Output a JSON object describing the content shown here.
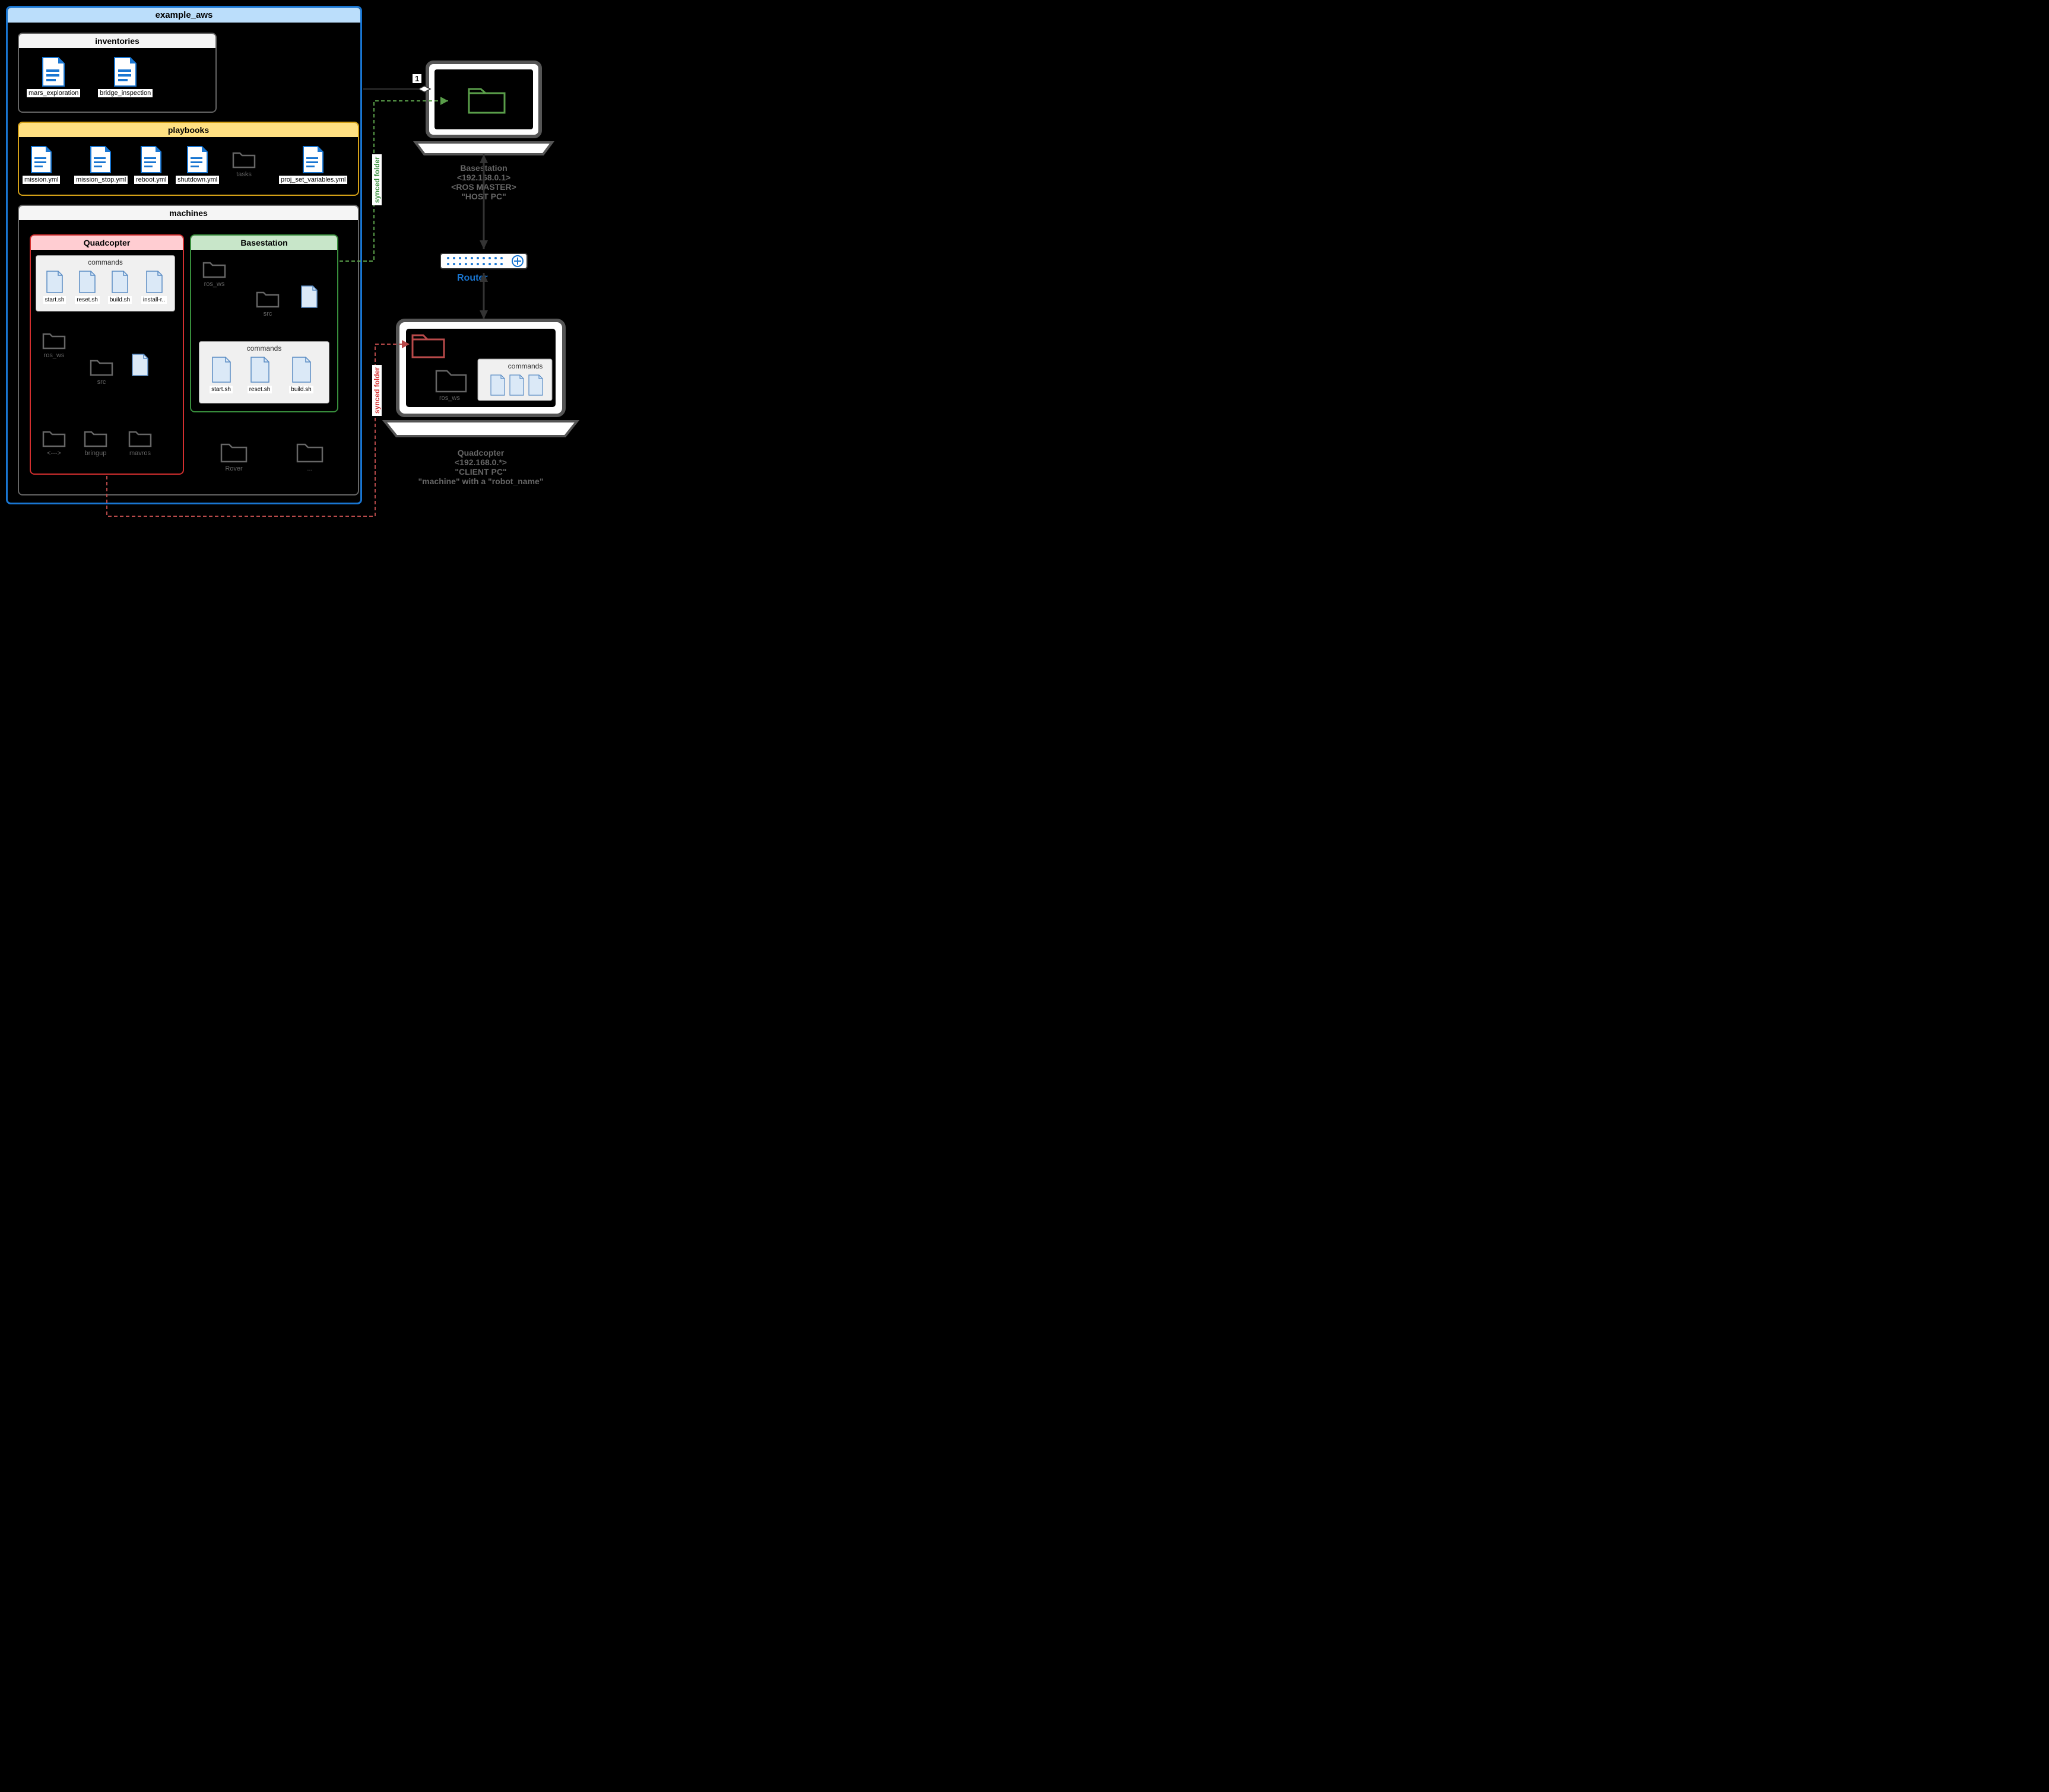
{
  "main": {
    "title": "example_aws"
  },
  "inventories": {
    "title": "inventories",
    "files": [
      "mars_exploration",
      "bridge_inspection"
    ]
  },
  "playbooks": {
    "title": "playbooks",
    "files": [
      "mission.yml",
      "mission_stop.yml",
      "reboot.yml",
      "shutdown.yml"
    ],
    "tasks_folder": "tasks",
    "last_file": "proj_set_variables.yml"
  },
  "machines": {
    "title": "machines",
    "quadcopter": {
      "title": "Quadcopter",
      "commands_title": "commands",
      "commands": [
        "start.sh",
        "reset.sh",
        "build.sh",
        "install-r.."
      ],
      "folders": {
        "ros_ws": "ros_ws",
        "src": "src",
        "bringup": "bringup",
        "mavros": "mavros",
        "placeholder": "<--->"
      }
    },
    "basestation": {
      "title": "Basestation",
      "commands_title": "commands",
      "commands": [
        "start.sh",
        "reset.sh",
        "build.sh"
      ],
      "folders": {
        "ros_ws": "ros_ws",
        "src": "src"
      }
    },
    "extra_folders": {
      "rover": "Rover",
      "etc": "..."
    }
  },
  "network": {
    "badge": "1",
    "synced_green": "synced folder",
    "synced_red": "synced folder",
    "basestation": {
      "name": "Basestation",
      "ip": "<192.168.0.1>",
      "ros": "<ROS MASTER>",
      "role": "\"HOST PC\""
    },
    "router": "Router",
    "quadcopter": {
      "name": "Quadcopter",
      "ip": "<192.168.0.*>",
      "role": "\"CLIENT PC\"",
      "desc": "\"machine\" with a \"robot_name\"",
      "commands_title": "commands",
      "ros_ws": "ros_ws"
    }
  }
}
